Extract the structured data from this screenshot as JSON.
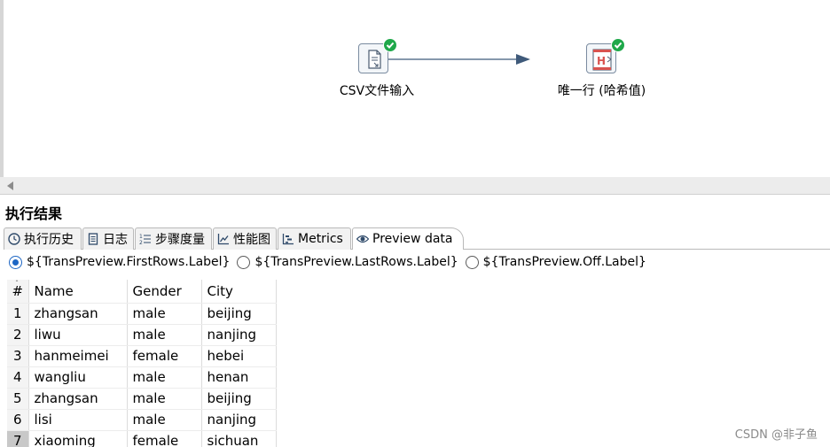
{
  "canvas": {
    "steps": [
      {
        "name": "csv-input-step",
        "label": "CSV文件输入"
      },
      {
        "name": "unique-rows-step",
        "label": "唯一行 (哈希值)"
      }
    ]
  },
  "results": {
    "title": "执行结果",
    "tabs": [
      {
        "label": "执行历史",
        "icon": "clock-icon"
      },
      {
        "label": "日志",
        "icon": "document-icon"
      },
      {
        "label": "步骤度量",
        "icon": "numbered-list-icon"
      },
      {
        "label": "性能图",
        "icon": "line-chart-icon"
      },
      {
        "label": "Metrics",
        "icon": "tree-chart-icon"
      },
      {
        "label": "Preview data",
        "icon": "eye-icon",
        "active": true
      }
    ],
    "preview_options": [
      {
        "label": "${TransPreview.FirstRows.Label}",
        "checked": true
      },
      {
        "label": "${TransPreview.LastRows.Label}",
        "checked": false
      },
      {
        "label": "${TransPreview.Off.Label}",
        "checked": false
      }
    ],
    "table": {
      "columns": [
        "#",
        "Name",
        "Gender",
        "City"
      ],
      "rows": [
        [
          "1",
          "zhangsan",
          "male",
          "beijing"
        ],
        [
          "2",
          "liwu",
          "male",
          "nanjing"
        ],
        [
          "3",
          "hanmeimei",
          "female",
          "hebei"
        ],
        [
          "4",
          "wangliu",
          "male",
          "henan"
        ],
        [
          "5",
          "zhangsan",
          "male",
          "beijing"
        ],
        [
          "6",
          "lisi",
          "male",
          "nanjing"
        ],
        [
          "7",
          "xiaoming",
          "female",
          "sichuan"
        ]
      ]
    }
  },
  "watermark": "CSDN @非子鱼",
  "colors": {
    "success": "#1fa84a",
    "hop": "#3f5a7a",
    "accent": "#1d66c4"
  }
}
